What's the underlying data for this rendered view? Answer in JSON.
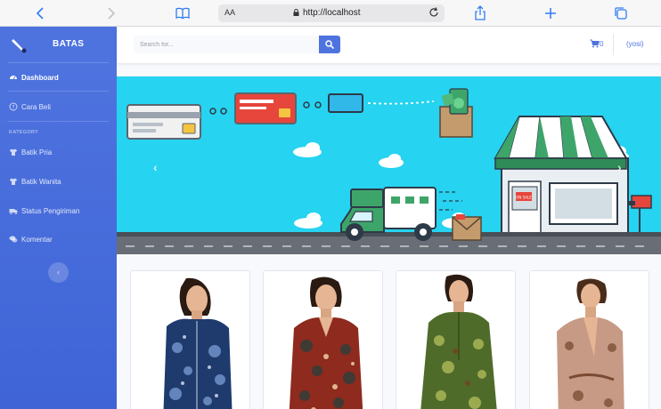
{
  "browser": {
    "text_size_label": "AA",
    "url": "http://localhost"
  },
  "sidebar": {
    "brand": "BATAS",
    "heading": "KATEGORY",
    "items": [
      {
        "label": "Dashboard",
        "icon": "gauge-icon"
      },
      {
        "label": "Cara Beli",
        "icon": "question-icon"
      },
      {
        "label": "Batik Pria",
        "icon": "shirt-icon"
      },
      {
        "label": "Batik Wanita",
        "icon": "shirt-icon"
      },
      {
        "label": "Status Pengiriman",
        "icon": "truck-icon"
      },
      {
        "label": "Komentar",
        "icon": "comments-icon"
      }
    ],
    "toggle_icon": "‹"
  },
  "topbar": {
    "search_placeholder": "Search for...",
    "cart_count": "0",
    "user": "(yosi)"
  },
  "banner": {
    "prev": "‹",
    "next": "›",
    "sign_text": "ON SALE"
  },
  "colors": {
    "primary": "#4e73df",
    "banner_sky": "#26d3f0",
    "road": "#696d75"
  },
  "products": [
    {
      "name": "batik-blue-blouse"
    },
    {
      "name": "batik-red-blouse"
    },
    {
      "name": "batik-green-blouse"
    },
    {
      "name": "batik-brown-blouse"
    }
  ]
}
